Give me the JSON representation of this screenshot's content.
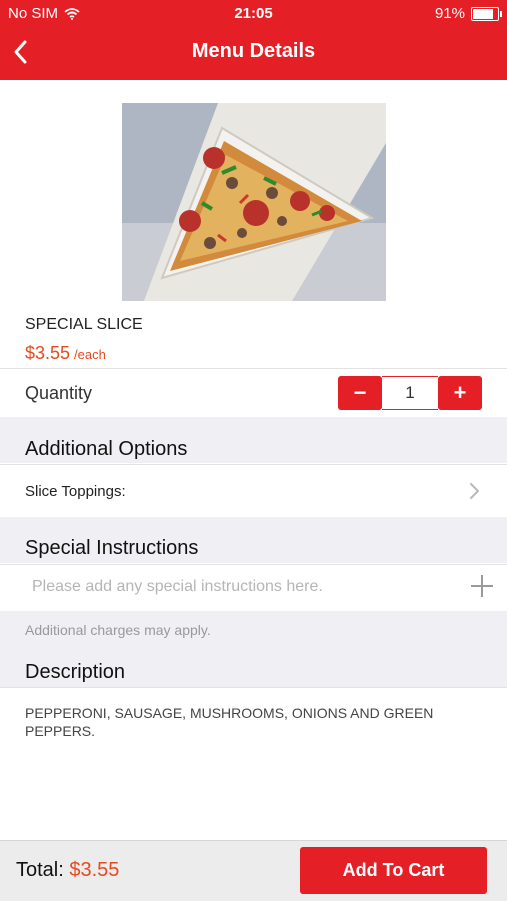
{
  "status_bar": {
    "carrier": "No SIM",
    "time": "21:05",
    "battery": "91%",
    "battery_level": 0.91
  },
  "nav": {
    "title": "Menu Details"
  },
  "item": {
    "name": "SPECIAL SLICE",
    "price": "$3.55",
    "price_unit": "/each"
  },
  "quantity": {
    "label": "Quantity",
    "minus": "−",
    "value": "1",
    "plus": "+"
  },
  "options": {
    "heading": "Additional Options",
    "toppings_label": "Slice Toppings:"
  },
  "instructions": {
    "heading": "Special Instructions",
    "placeholder": "Please add any special instructions here.",
    "note": "Additional charges may apply."
  },
  "description": {
    "heading": "Description",
    "text": "PEPPERONI, SAUSAGE, MUSHROOMS, ONIONS AND GREEN PEPPERS."
  },
  "footer": {
    "total_label": "Total:",
    "total_value": "$3.55",
    "add_to_cart": "Add To Cart"
  },
  "colors": {
    "brand_red": "#e41f26",
    "price_orange": "#e84a1e"
  }
}
